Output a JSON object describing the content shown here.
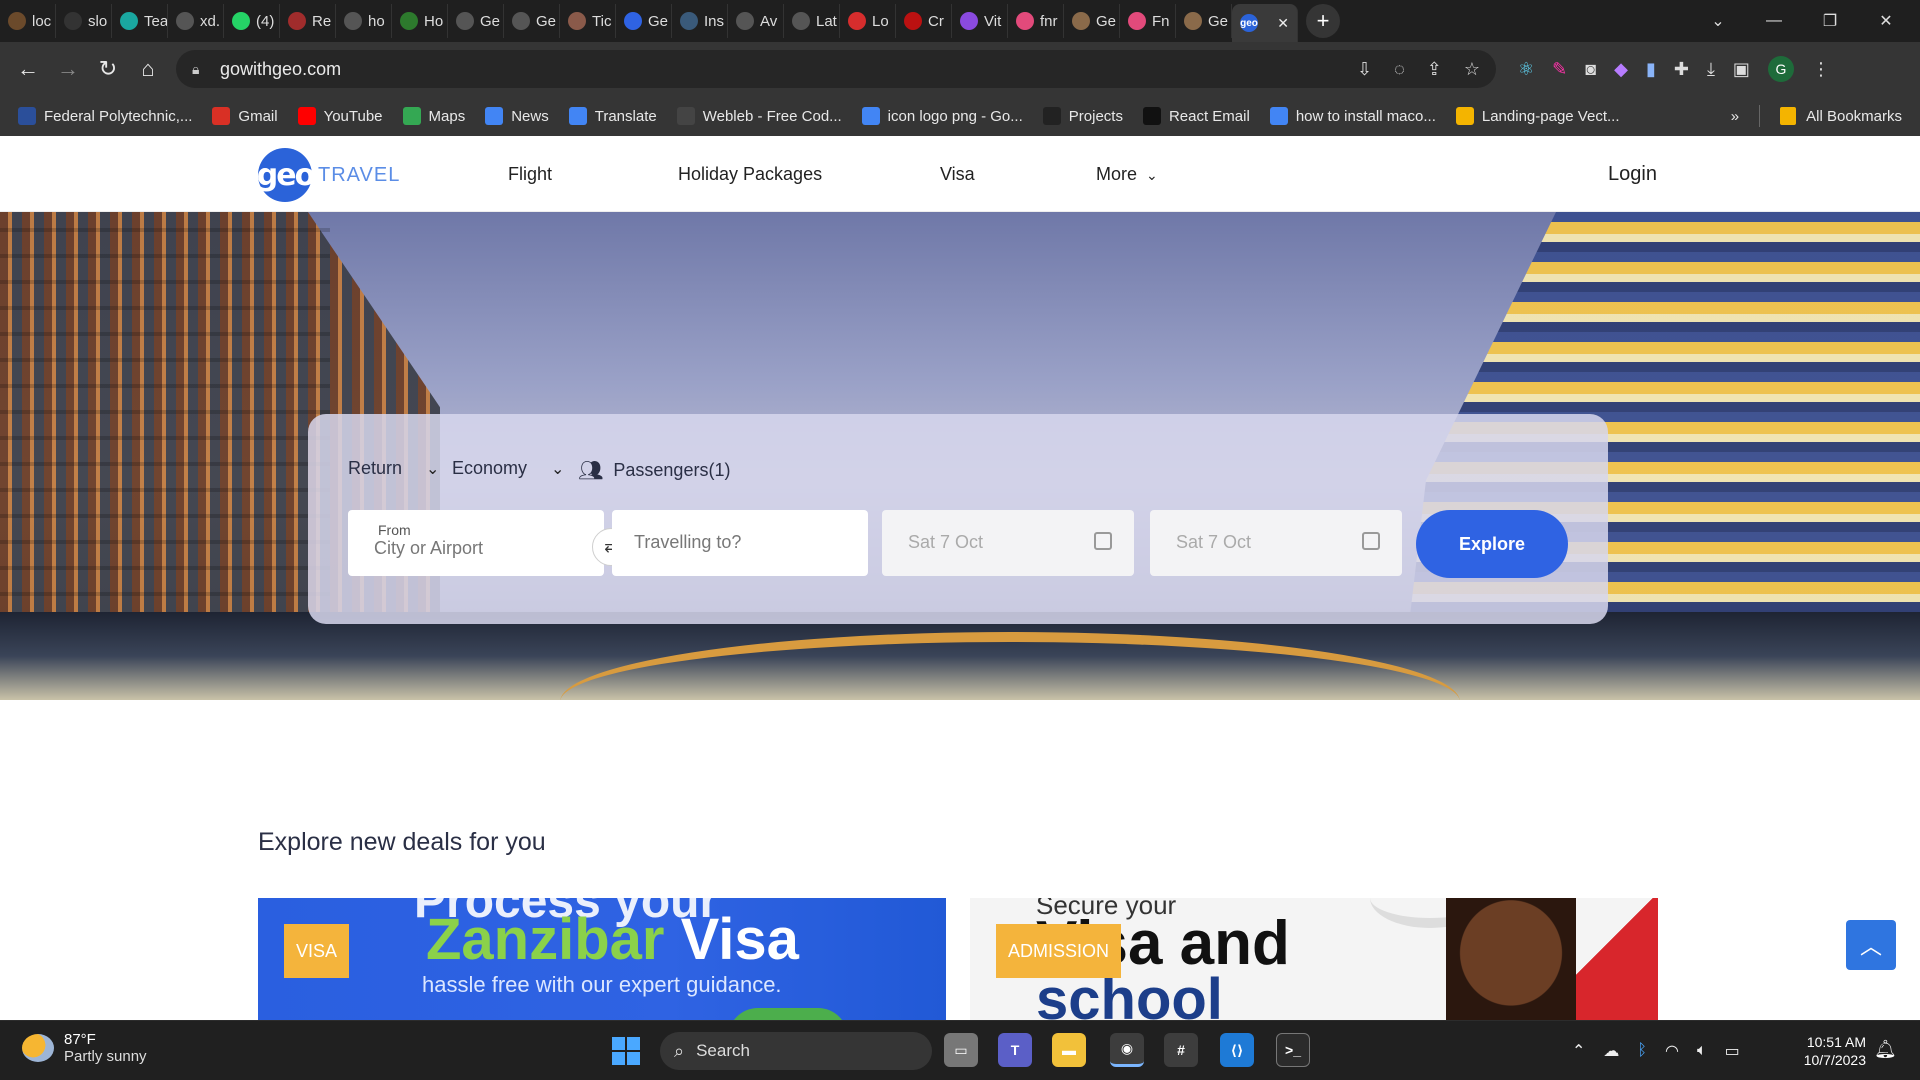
{
  "browser": {
    "tabs": [
      {
        "label": "loc",
        "color": "#6b4a2b"
      },
      {
        "label": "slo",
        "color": "#333333"
      },
      {
        "label": "Tea",
        "color": "#1aa7a0"
      },
      {
        "label": "xd.",
        "color": "#555555"
      },
      {
        "label": "(4)",
        "color": "#25d366"
      },
      {
        "label": "Re",
        "color": "#a02c2c"
      },
      {
        "label": "ho",
        "color": "#555555"
      },
      {
        "label": "Ho",
        "color": "#2d7a2d"
      },
      {
        "label": "Ge",
        "color": "#555555"
      },
      {
        "label": "Ge",
        "color": "#555555"
      },
      {
        "label": "Tic",
        "color": "#8a5a4a"
      },
      {
        "label": "Ge",
        "color": "#2f63e3"
      },
      {
        "label": "Ins",
        "color": "#3a5a7a"
      },
      {
        "label": "Av",
        "color": "#555555"
      },
      {
        "label": "Lat",
        "color": "#555555"
      },
      {
        "label": "Lo",
        "color": "#d62d2d"
      },
      {
        "label": "Cr",
        "color": "#b11"
      },
      {
        "label": "Vit",
        "color": "#8a4adf"
      },
      {
        "label": "fnr",
        "color": "#e24a7b"
      },
      {
        "label": "Ge",
        "color": "#8a6a4a"
      },
      {
        "label": "Fn",
        "color": "#e24a7b"
      },
      {
        "label": "Ge",
        "color": "#8a6a4a"
      }
    ],
    "active_tab": {
      "label": "geo",
      "color": "#2b63d9"
    },
    "url": "gowithgeo.com",
    "profile_initial": "G",
    "bookmarks": [
      {
        "label": "Federal Polytechnic,...",
        "color": "#2b4f9a"
      },
      {
        "label": "Gmail",
        "color": "#d93025"
      },
      {
        "label": "YouTube",
        "color": "#ff0000"
      },
      {
        "label": "Maps",
        "color": "#34a853"
      },
      {
        "label": "News",
        "color": "#4285f4"
      },
      {
        "label": "Translate",
        "color": "#4285f4"
      },
      {
        "label": "Webleb - Free Cod...",
        "color": "#444444"
      },
      {
        "label": "icon logo png - Go...",
        "color": "#4285f4"
      },
      {
        "label": "Projects",
        "color": "#222222"
      },
      {
        "label": "React Email",
        "color": "#111111"
      },
      {
        "label": "how to install maco...",
        "color": "#4285f4"
      },
      {
        "label": "Landing-page Vect...",
        "color": "#f4b400"
      }
    ],
    "all_bookmarks_label": "All Bookmarks",
    "chevron": "»"
  },
  "site": {
    "logo_mark": "geo",
    "logo_text": "TRAVEL",
    "nav": [
      "Flight",
      "Holiday Packages",
      "Visa",
      "More"
    ],
    "login": "Login"
  },
  "search": {
    "trip_type": "Return",
    "cabin": "Economy",
    "passengers": "Passengers(1)",
    "from_label": "From",
    "from_placeholder": "City or Airport",
    "to_placeholder": "Travelling to?",
    "depart_date": "Sat 7 Oct",
    "return_date": "Sat 7 Oct",
    "explore": "Explore"
  },
  "deals": {
    "title": "Explore new deals for you",
    "cards": [
      {
        "badge": "VISA",
        "top_text": "Process your",
        "highlight": "Zanzibar",
        "main": "Visa",
        "sub": "hassle free with our expert guidance."
      },
      {
        "badge": "ADMISSION",
        "top_text": "Secure your",
        "main": "Visa and",
        "line2": "school"
      }
    ]
  },
  "taskbar": {
    "temp": "87°F",
    "weather": "Partly sunny",
    "search": "Search",
    "time": "10:51 AM",
    "date": "10/7/2023"
  }
}
